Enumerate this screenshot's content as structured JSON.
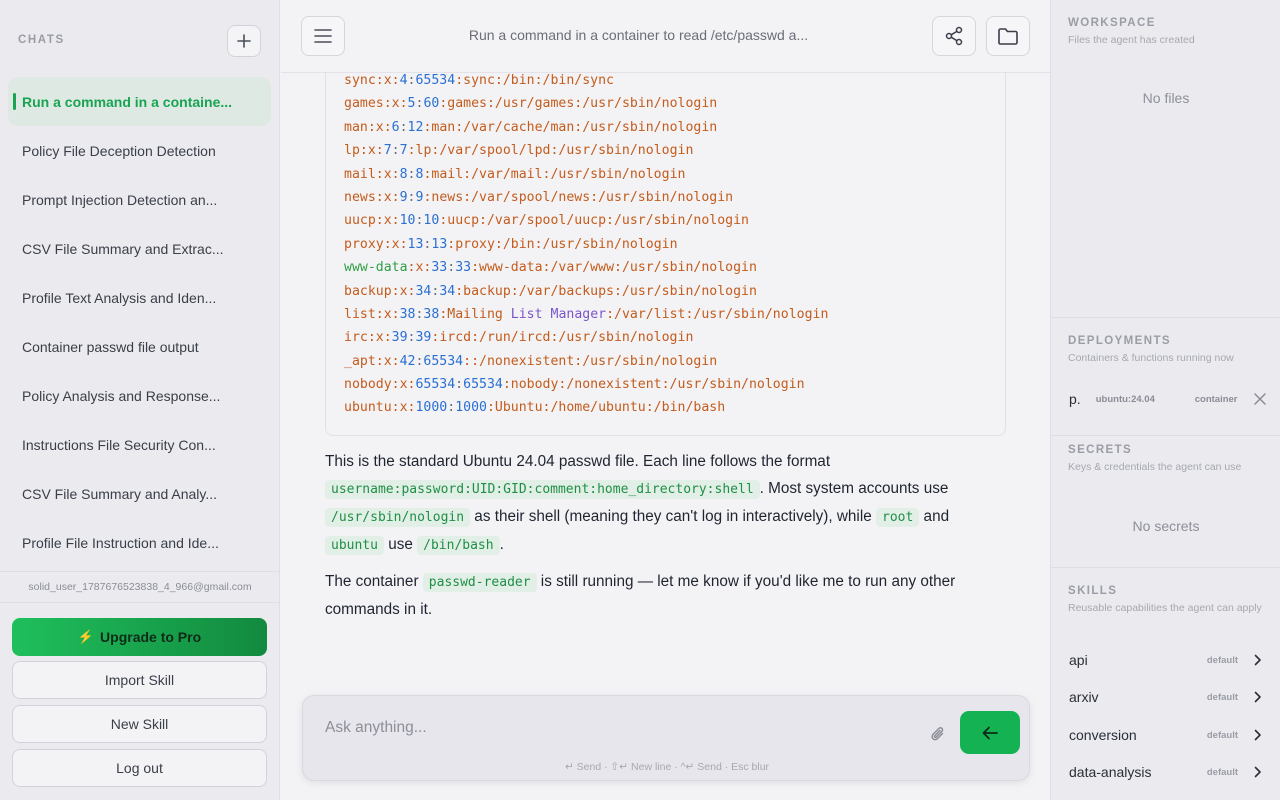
{
  "sidebar": {
    "heading": "CHATS",
    "chats": [
      "Run a command in a containe...",
      "Policy File Deception Detection",
      "Prompt Injection Detection an...",
      "CSV File Summary and Extrac...",
      "Profile Text Analysis and Iden...",
      "Container passwd file output",
      "Policy Analysis and Response...",
      "Instructions File Security Con...",
      "CSV File Summary and Analy...",
      "Profile File Instruction and Ide..."
    ],
    "user_email": "solid_user_1787676523838_4_966@gmail.com",
    "upgrade_label": "Upgrade to Pro",
    "import_label": "Import Skill",
    "new_skill_label": "New Skill",
    "logout_label": "Log out"
  },
  "header": {
    "title": "Run a command in a container to read /etc/passwd a..."
  },
  "code": {
    "lines": [
      [
        [
          "sync:x:",
          "o"
        ],
        [
          "4",
          "b"
        ],
        [
          ":",
          "d"
        ],
        [
          "65534",
          "b"
        ],
        [
          ":sync:/bin:/bin/sync",
          "o"
        ]
      ],
      [
        [
          "games:x:",
          "o"
        ],
        [
          "5",
          "b"
        ],
        [
          ":",
          "d"
        ],
        [
          "60",
          "b"
        ],
        [
          ":games:/usr/games:/usr/sbin/nologin",
          "o"
        ]
      ],
      [
        [
          "man:x:",
          "o"
        ],
        [
          "6",
          "b"
        ],
        [
          ":",
          "d"
        ],
        [
          "12",
          "b"
        ],
        [
          ":man:/var/cache/man:/usr/sbin/nologin",
          "o"
        ]
      ],
      [
        [
          "lp:x:",
          "o"
        ],
        [
          "7",
          "b"
        ],
        [
          ":",
          "d"
        ],
        [
          "7",
          "b"
        ],
        [
          ":lp:/var/spool/lpd:/usr/sbin/nologin",
          "o"
        ]
      ],
      [
        [
          "mail:x:",
          "o"
        ],
        [
          "8",
          "b"
        ],
        [
          ":",
          "d"
        ],
        [
          "8",
          "b"
        ],
        [
          ":mail:/var/mail:/usr/sbin/nologin",
          "o"
        ]
      ],
      [
        [
          "news:x:",
          "o"
        ],
        [
          "9",
          "b"
        ],
        [
          ":",
          "d"
        ],
        [
          "9",
          "b"
        ],
        [
          ":news:/var/spool/news:/usr/sbin/nologin",
          "o"
        ]
      ],
      [
        [
          "uucp:x:",
          "o"
        ],
        [
          "10",
          "b"
        ],
        [
          ":",
          "d"
        ],
        [
          "10",
          "b"
        ],
        [
          ":uucp:/var/spool/uucp:/usr/sbin/nologin",
          "o"
        ]
      ],
      [
        [
          "proxy:x:",
          "o"
        ],
        [
          "13",
          "b"
        ],
        [
          ":",
          "d"
        ],
        [
          "13",
          "b"
        ],
        [
          ":proxy:/bin:/usr/sbin/nologin",
          "o"
        ]
      ],
      [
        [
          "www-data",
          "g"
        ],
        [
          ":x:",
          "o"
        ],
        [
          "33",
          "b"
        ],
        [
          ":",
          "d"
        ],
        [
          "33",
          "b"
        ],
        [
          ":www-data:/var/www:/usr/sbin/nologin",
          "o"
        ]
      ],
      [
        [
          "backup:x:",
          "o"
        ],
        [
          "34",
          "b"
        ],
        [
          ":",
          "d"
        ],
        [
          "34",
          "b"
        ],
        [
          ":backup:/var/backups:/usr/sbin/nologin",
          "o"
        ]
      ],
      [
        [
          "list:x:",
          "o"
        ],
        [
          "38",
          "b"
        ],
        [
          ":",
          "d"
        ],
        [
          "38",
          "b"
        ],
        [
          ":Mailing ",
          "o"
        ],
        [
          "List",
          "p"
        ],
        [
          " ",
          "o"
        ],
        [
          "Manager",
          "p"
        ],
        [
          ":/var/list:/usr/sbin/nologin",
          "o"
        ]
      ],
      [
        [
          "irc:x:",
          "o"
        ],
        [
          "39",
          "b"
        ],
        [
          ":",
          "d"
        ],
        [
          "39",
          "b"
        ],
        [
          ":ircd:/run/ircd:/usr/sbin/nologin",
          "o"
        ]
      ],
      [
        [
          "_apt:x:",
          "o"
        ],
        [
          "42",
          "b"
        ],
        [
          ":",
          "d"
        ],
        [
          "65534",
          "b"
        ],
        [
          "::/nonexistent:/usr/sbin/nologin",
          "o"
        ]
      ],
      [
        [
          "nobody:x:",
          "o"
        ],
        [
          "65534",
          "b"
        ],
        [
          ":",
          "d"
        ],
        [
          "65534",
          "b"
        ],
        [
          ":nobody:/nonexistent:/usr/sbin/nologin",
          "o"
        ]
      ],
      [
        [
          "ubuntu:x:",
          "o"
        ],
        [
          "1000",
          "b"
        ],
        [
          ":",
          "d"
        ],
        [
          "1000",
          "b"
        ],
        [
          ":Ubuntu:/home/ubuntu:/bin/bash",
          "o"
        ]
      ]
    ]
  },
  "message": {
    "p1": [
      [
        "t",
        "This is the standard Ubuntu 24.04 passwd file. Each line follows the format "
      ],
      [
        "c",
        "username:password:UID:GID:comment:home_directory:shell"
      ],
      [
        "t",
        ". Most system accounts use "
      ],
      [
        "c",
        "/usr/sbin/nologin"
      ],
      [
        "t",
        " as their shell (meaning they can't log in interactively), while "
      ],
      [
        "c",
        "root"
      ],
      [
        "t",
        " and "
      ],
      [
        "c",
        "ubuntu"
      ],
      [
        "t",
        " use "
      ],
      [
        "c",
        "/bin/bash"
      ],
      [
        "t",
        "."
      ]
    ],
    "p2": [
      [
        "t",
        "The container "
      ],
      [
        "c",
        "passwd-reader"
      ],
      [
        "t",
        " is still running — let me know if you'd like me to run any other commands in it."
      ]
    ]
  },
  "composer": {
    "placeholder": "Ask anything...",
    "hint": "↵ Send · ⇧↵ New line · ^↵ Send · Esc blur"
  },
  "workspace": {
    "title": "WORKSPACE",
    "subtitle": "Files the agent has created",
    "empty": "No files"
  },
  "deployments": {
    "title": "DEPLOYMENTS",
    "subtitle": "Containers & functions running now",
    "items": [
      {
        "name": "p.",
        "image": "ubuntu:24.04",
        "type": "container"
      }
    ]
  },
  "secrets": {
    "title": "SECRETS",
    "subtitle": "Keys & credentials the agent can use",
    "empty": "No secrets"
  },
  "skills": {
    "title": "SKILLS",
    "subtitle": "Reusable capabilities the agent can apply",
    "items": [
      {
        "name": "api",
        "tag": "default"
      },
      {
        "name": "arxiv",
        "tag": "default"
      },
      {
        "name": "conversion",
        "tag": "default"
      },
      {
        "name": "data-analysis",
        "tag": "default"
      }
    ]
  },
  "colors": {
    "accent": "#15b254",
    "code_orange": "#c45c1c",
    "code_blue": "#2a6fd1",
    "code_green": "#2f9e44",
    "code_purple": "#7a55c9"
  }
}
